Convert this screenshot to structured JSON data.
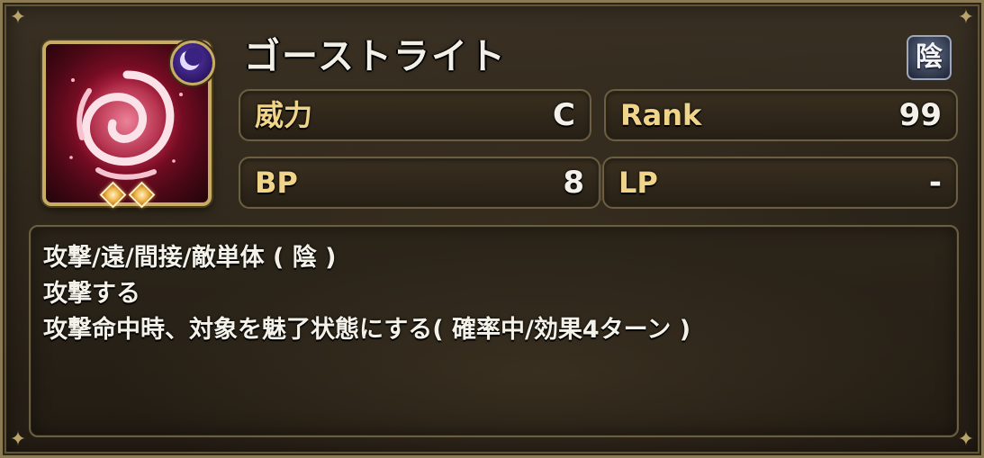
{
  "skill": {
    "name": "ゴーストライト",
    "attribute_badge": "陰",
    "icon": "crimson-swirl-icon",
    "slot_badge_icon": "crescent-moon-icon",
    "gem_count": 2
  },
  "stats": {
    "power_label": "威力",
    "power_value": "C",
    "rank_label": "Rank",
    "rank_value": "99",
    "bp_label": "BP",
    "bp_value": "8",
    "lp_label": "LP",
    "lp_value": "-"
  },
  "description": {
    "line1": "攻撃/遠/間接/敵単体 ( 陰 )",
    "line2": "攻撃する",
    "line3": "攻撃命中時、対象を魅了状態にする( 確率中/効果4ターン )"
  },
  "colors": {
    "label_gold": "#f0d48a",
    "frame_gold": "#c9ac64",
    "text_white": "#f4f1e8"
  }
}
